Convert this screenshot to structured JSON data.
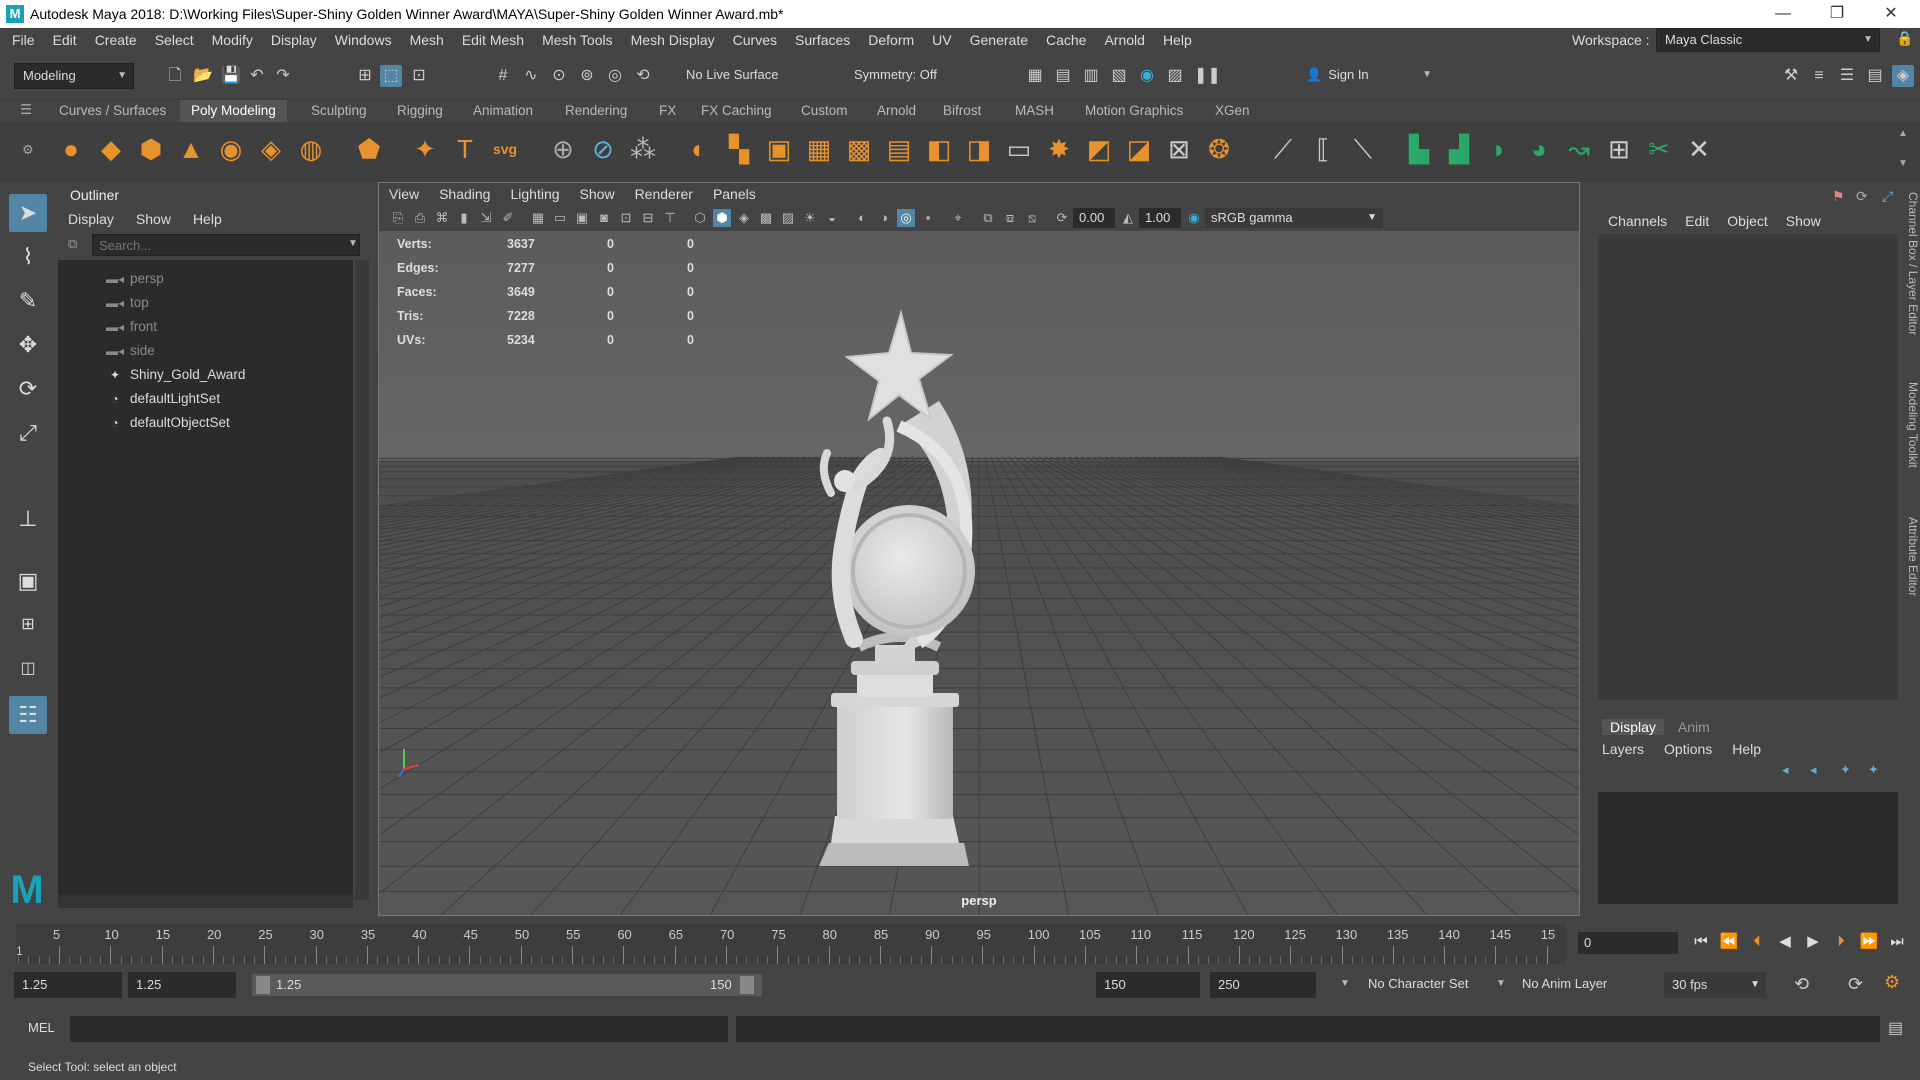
{
  "title": "Autodesk Maya 2018: D:\\Working Files\\Super-Shiny Golden Winner Award\\MAYA\\Super-Shiny Golden Winner Award.mb*",
  "menus": [
    "File",
    "Edit",
    "Create",
    "Select",
    "Modify",
    "Display",
    "Windows",
    "Mesh",
    "Edit Mesh",
    "Mesh Tools",
    "Mesh Display",
    "Curves",
    "Surfaces",
    "Deform",
    "UV",
    "Generate",
    "Cache",
    "Arnold",
    "Help"
  ],
  "workspace": {
    "label": "Workspace :",
    "value": "Maya Classic"
  },
  "toolbar": {
    "mode": "Modeling",
    "live_surface": "No Live Surface",
    "symmetry": "Symmetry: Off",
    "sign_in": "Sign In"
  },
  "shelf_tabs": [
    "Curves / Surfaces",
    "Poly Modeling",
    "Sculpting",
    "Rigging",
    "Animation",
    "Rendering",
    "FX",
    "FX Caching",
    "Custom",
    "Arnold",
    "Bifrost",
    "MASH",
    "Motion Graphics",
    "XGen"
  ],
  "shelf_active": "Poly Modeling",
  "outliner": {
    "title": "Outliner",
    "menu": [
      "Display",
      "Show",
      "Help"
    ],
    "search_placeholder": "Search...",
    "items": [
      {
        "label": "persp",
        "icon": "camera-icon",
        "dim": true
      },
      {
        "label": "top",
        "icon": "camera-icon",
        "dim": true
      },
      {
        "label": "front",
        "icon": "camera-icon",
        "dim": true
      },
      {
        "label": "side",
        "icon": "camera-icon",
        "dim": true
      },
      {
        "label": "Shiny_Gold_Award",
        "icon": "transform-icon",
        "dim": false
      },
      {
        "label": "defaultLightSet",
        "icon": "set-icon",
        "dim": false
      },
      {
        "label": "defaultObjectSet",
        "icon": "set-icon",
        "dim": false
      }
    ]
  },
  "viewport": {
    "menu": [
      "View",
      "Shading",
      "Lighting",
      "Show",
      "Renderer",
      "Panels"
    ],
    "near": "0.00",
    "far": "1.00",
    "color_space": "sRGB gamma",
    "camera": "persp",
    "hud": [
      {
        "label": "Verts:",
        "v1": "3637",
        "v2": "0",
        "v3": "0"
      },
      {
        "label": "Edges:",
        "v1": "7277",
        "v2": "0",
        "v3": "0"
      },
      {
        "label": "Faces:",
        "v1": "3649",
        "v2": "0",
        "v3": "0"
      },
      {
        "label": "Tris:",
        "v1": "7228",
        "v2": "0",
        "v3": "0"
      },
      {
        "label": "UVs:",
        "v1": "5234",
        "v2": "0",
        "v3": "0"
      }
    ]
  },
  "channel_box": {
    "menu": [
      "Channels",
      "Edit",
      "Object",
      "Show"
    ]
  },
  "layer_panel": {
    "tabs": [
      "Display",
      "Anim"
    ],
    "menu": [
      "Layers",
      "Options",
      "Help"
    ]
  },
  "side_tabs": [
    "Channel Box / Layer Editor",
    "Modeling Toolkit",
    "Attribute Editor"
  ],
  "timeline": {
    "ticks": [
      "5",
      "10",
      "15",
      "20",
      "25",
      "30",
      "35",
      "40",
      "45",
      "50",
      "55",
      "60",
      "65",
      "70",
      "75",
      "80",
      "85",
      "90",
      "95",
      "100",
      "105",
      "110",
      "115",
      "120",
      "125",
      "130",
      "135",
      "140",
      "145",
      "15"
    ],
    "start_label": "1",
    "current_frame": "0"
  },
  "range": {
    "start": "1.25",
    "anim_start": "1.25",
    "slider_start": "1.25",
    "slider_end": "150",
    "anim_end": "150",
    "end": "250",
    "character_set": "No Character Set",
    "anim_layer": "No Anim Layer",
    "fps": "30 fps"
  },
  "command": {
    "label": "MEL"
  },
  "help_line": "Select Tool: select an object",
  "colors": {
    "accent": "#5285a6",
    "panel": "#444444",
    "field": "#2b2b2b",
    "viewport": "#5f5f5f"
  }
}
